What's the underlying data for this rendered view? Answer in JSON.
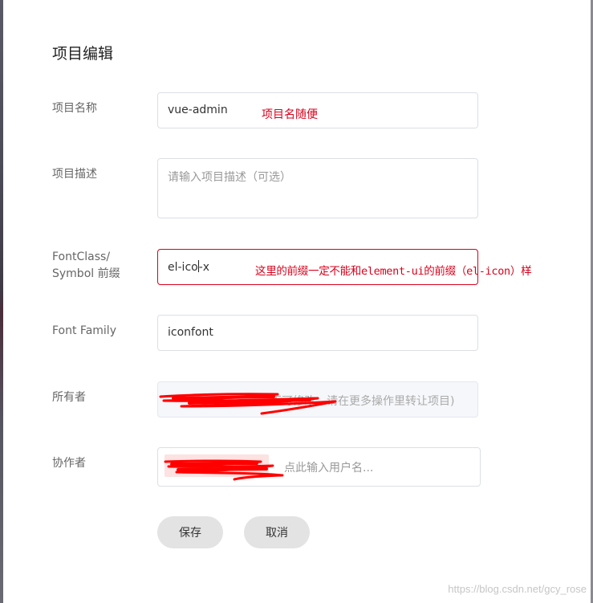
{
  "dialog": {
    "title": "项目编辑"
  },
  "form": {
    "project_name": {
      "label": "项目名称",
      "value": "vue-admin",
      "annotation": "项目名随便"
    },
    "project_desc": {
      "label": "项目描述",
      "placeholder": "请输入项目描述（可选）"
    },
    "prefix": {
      "label_line1": "FontClass/",
      "label_line2": "Symbol 前缀",
      "value_before_caret": "el-ico",
      "value_after_caret": "-x",
      "annotation": "这里的前缀一定不能和element-ui的前缀（el-icon）样"
    },
    "font_family": {
      "label": "Font Family",
      "value": "iconfont"
    },
    "owner": {
      "label": "所有者",
      "value": "不可修改，请在更多操作里转让项目)"
    },
    "collaborators": {
      "label": "协作者",
      "placeholder": "点此输入用户名..."
    }
  },
  "actions": {
    "save_label": "保存",
    "cancel_label": "取消"
  },
  "watermark": "https://blog.csdn.net/gcy_rose",
  "colors": {
    "annotation_red": "#d9001b",
    "button_gray": "#e3e3e3",
    "border": "#dcdfe6"
  }
}
